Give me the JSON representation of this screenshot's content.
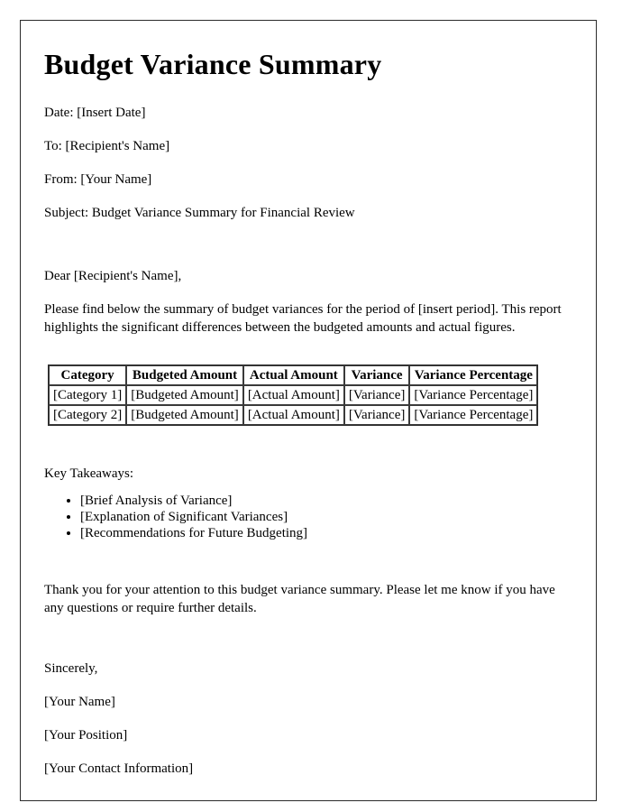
{
  "document": {
    "title": "Budget Variance Summary",
    "meta": [
      {
        "name": "date-line",
        "text": "Date: [Insert Date]"
      },
      {
        "name": "to-line",
        "text": "To: [Recipient's Name]"
      },
      {
        "name": "from-line",
        "text": "From: [Your Name]"
      },
      {
        "name": "subject-line",
        "text": "Subject: Budget Variance Summary for Financial Review"
      }
    ],
    "salutation": "Dear [Recipient's Name],",
    "intro_paragraph": "Please find below the summary of budget variances for the period of [insert period]. This report highlights the significant differences between the budgeted amounts and actual figures.",
    "table": {
      "headers": [
        "Category",
        "Budgeted Amount",
        "Actual Amount",
        "Variance",
        "Variance Percentage"
      ],
      "rows": [
        [
          "[Category 1]",
          "[Budgeted Amount]",
          "[Actual Amount]",
          "[Variance]",
          "[Variance Percentage]"
        ],
        [
          "[Category 2]",
          "[Budgeted Amount]",
          "[Actual Amount]",
          "[Variance]",
          "[Variance Percentage]"
        ]
      ]
    },
    "takeaways_label": "Key Takeaways:",
    "takeaways": [
      "[Brief Analysis of Variance]",
      "[Explanation of Significant Variances]",
      "[Recommendations for Future Budgeting]"
    ],
    "closing_paragraph": "Thank you for your attention to this budget variance summary. Please let me know if you have any questions or require further details.",
    "sign_off": "Sincerely,",
    "signature": [
      {
        "name": "signature-name",
        "text": "[Your Name]"
      },
      {
        "name": "signature-position",
        "text": "[Your Position]"
      },
      {
        "name": "signature-contact",
        "text": "[Your Contact Information]"
      }
    ]
  },
  "colors": {
    "page_background": "#ffffff",
    "text": "#000000",
    "page_border": "#2b2b2b",
    "table_border": "#3a3a3a"
  }
}
